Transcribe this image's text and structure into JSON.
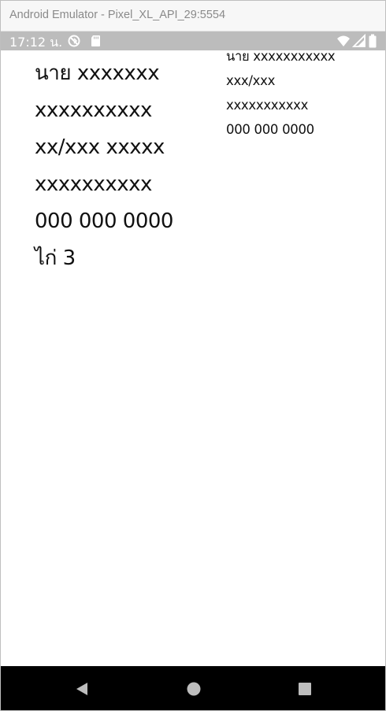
{
  "window": {
    "title": "Android Emulator - Pixel_XL_API_29:5554"
  },
  "statusbar": {
    "time": "17:12 น.",
    "icons": [
      "sync-icon",
      "sd-card-icon",
      "wifi-icon",
      "cellular-signal-icon",
      "battery-icon"
    ],
    "color": "#ffffff",
    "background": "#bcbcbc"
  },
  "left_card": {
    "lines": [
      "นาย xxxxxxx",
      "xxxxxxxxxx",
      "xx/xxx xxxxx",
      "xxxxxxxxxx",
      "000 000 0000",
      "ไก่ 3"
    ]
  },
  "right_card": {
    "lines": [
      "นาย xxxxxxxxxxx",
      "xxx/xxx",
      "xxxxxxxxxxx",
      "000 000 0000"
    ]
  },
  "navbar": {
    "buttons": [
      "back-icon",
      "home-icon",
      "recents-icon"
    ],
    "background": "#000000",
    "icon_color": "#bdbdbd"
  }
}
